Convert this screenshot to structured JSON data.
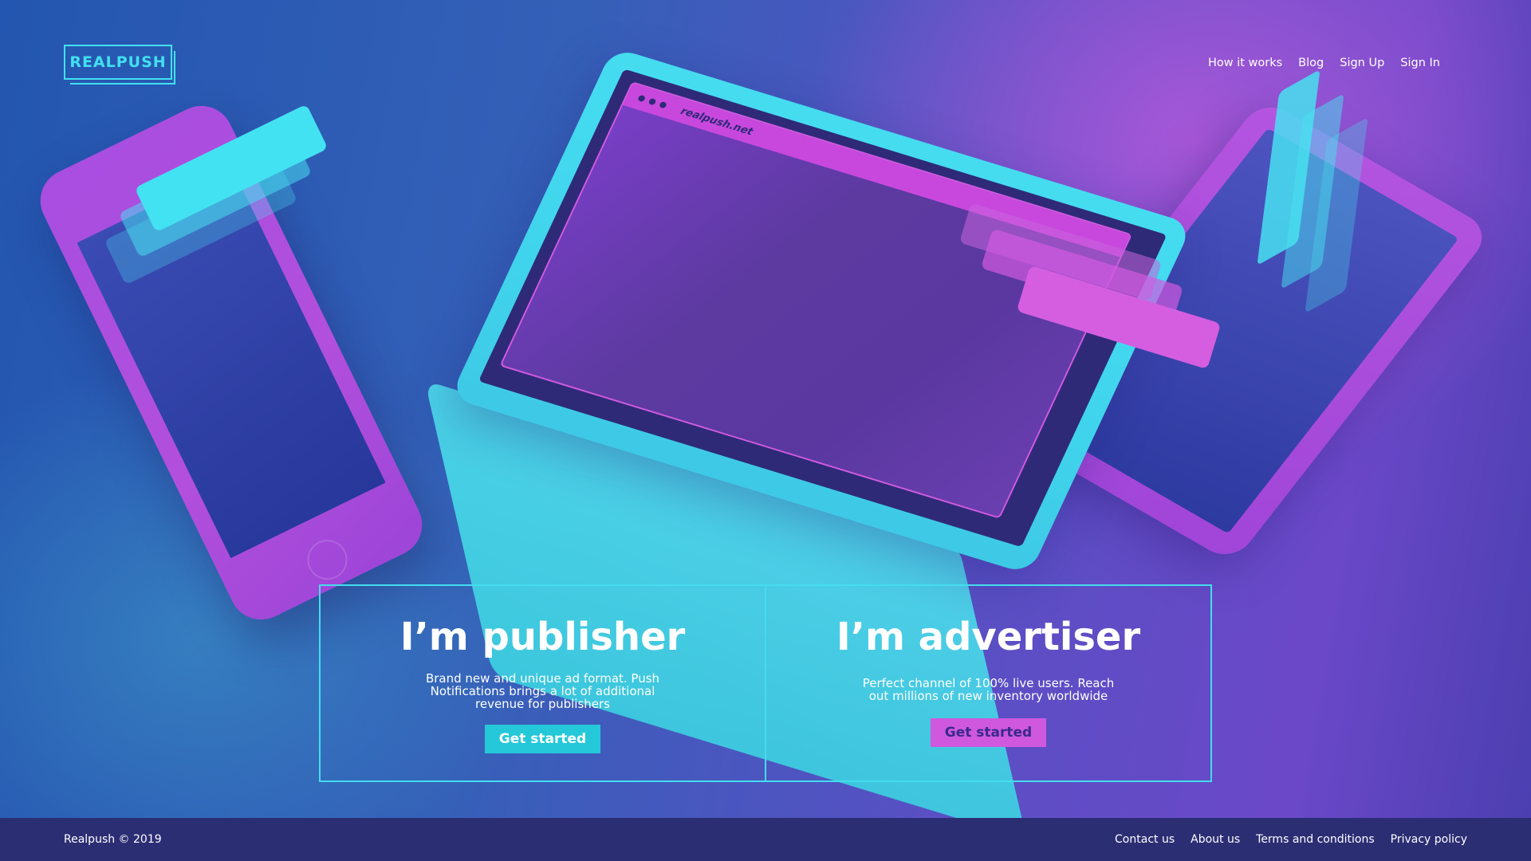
{
  "header": {
    "logo": "REALPUSH",
    "nav": [
      "How it works",
      "Blog",
      "Sign Up",
      "Sign In"
    ]
  },
  "hero": {
    "browser_url": "realpush.net",
    "publisher": {
      "title": "I’m publisher",
      "description": "Brand new and unique ad format. Push Notifications brings a lot of additional revenue for publishers",
      "button": "Get started"
    },
    "advertiser": {
      "title": "I’m advertiser",
      "description": "Perfect channel of 100% live users. Reach out millions of new inventory worldwide",
      "button": "Get started"
    }
  },
  "footer": {
    "copyright": "Realpush © 2019",
    "links": [
      "Contact us",
      "About us",
      "Terms and conditions",
      "Privacy policy"
    ]
  },
  "colors": {
    "accent_cyan": "#44dcee",
    "accent_pink": "#cf58de",
    "footer_bg": "#2c2e74"
  }
}
